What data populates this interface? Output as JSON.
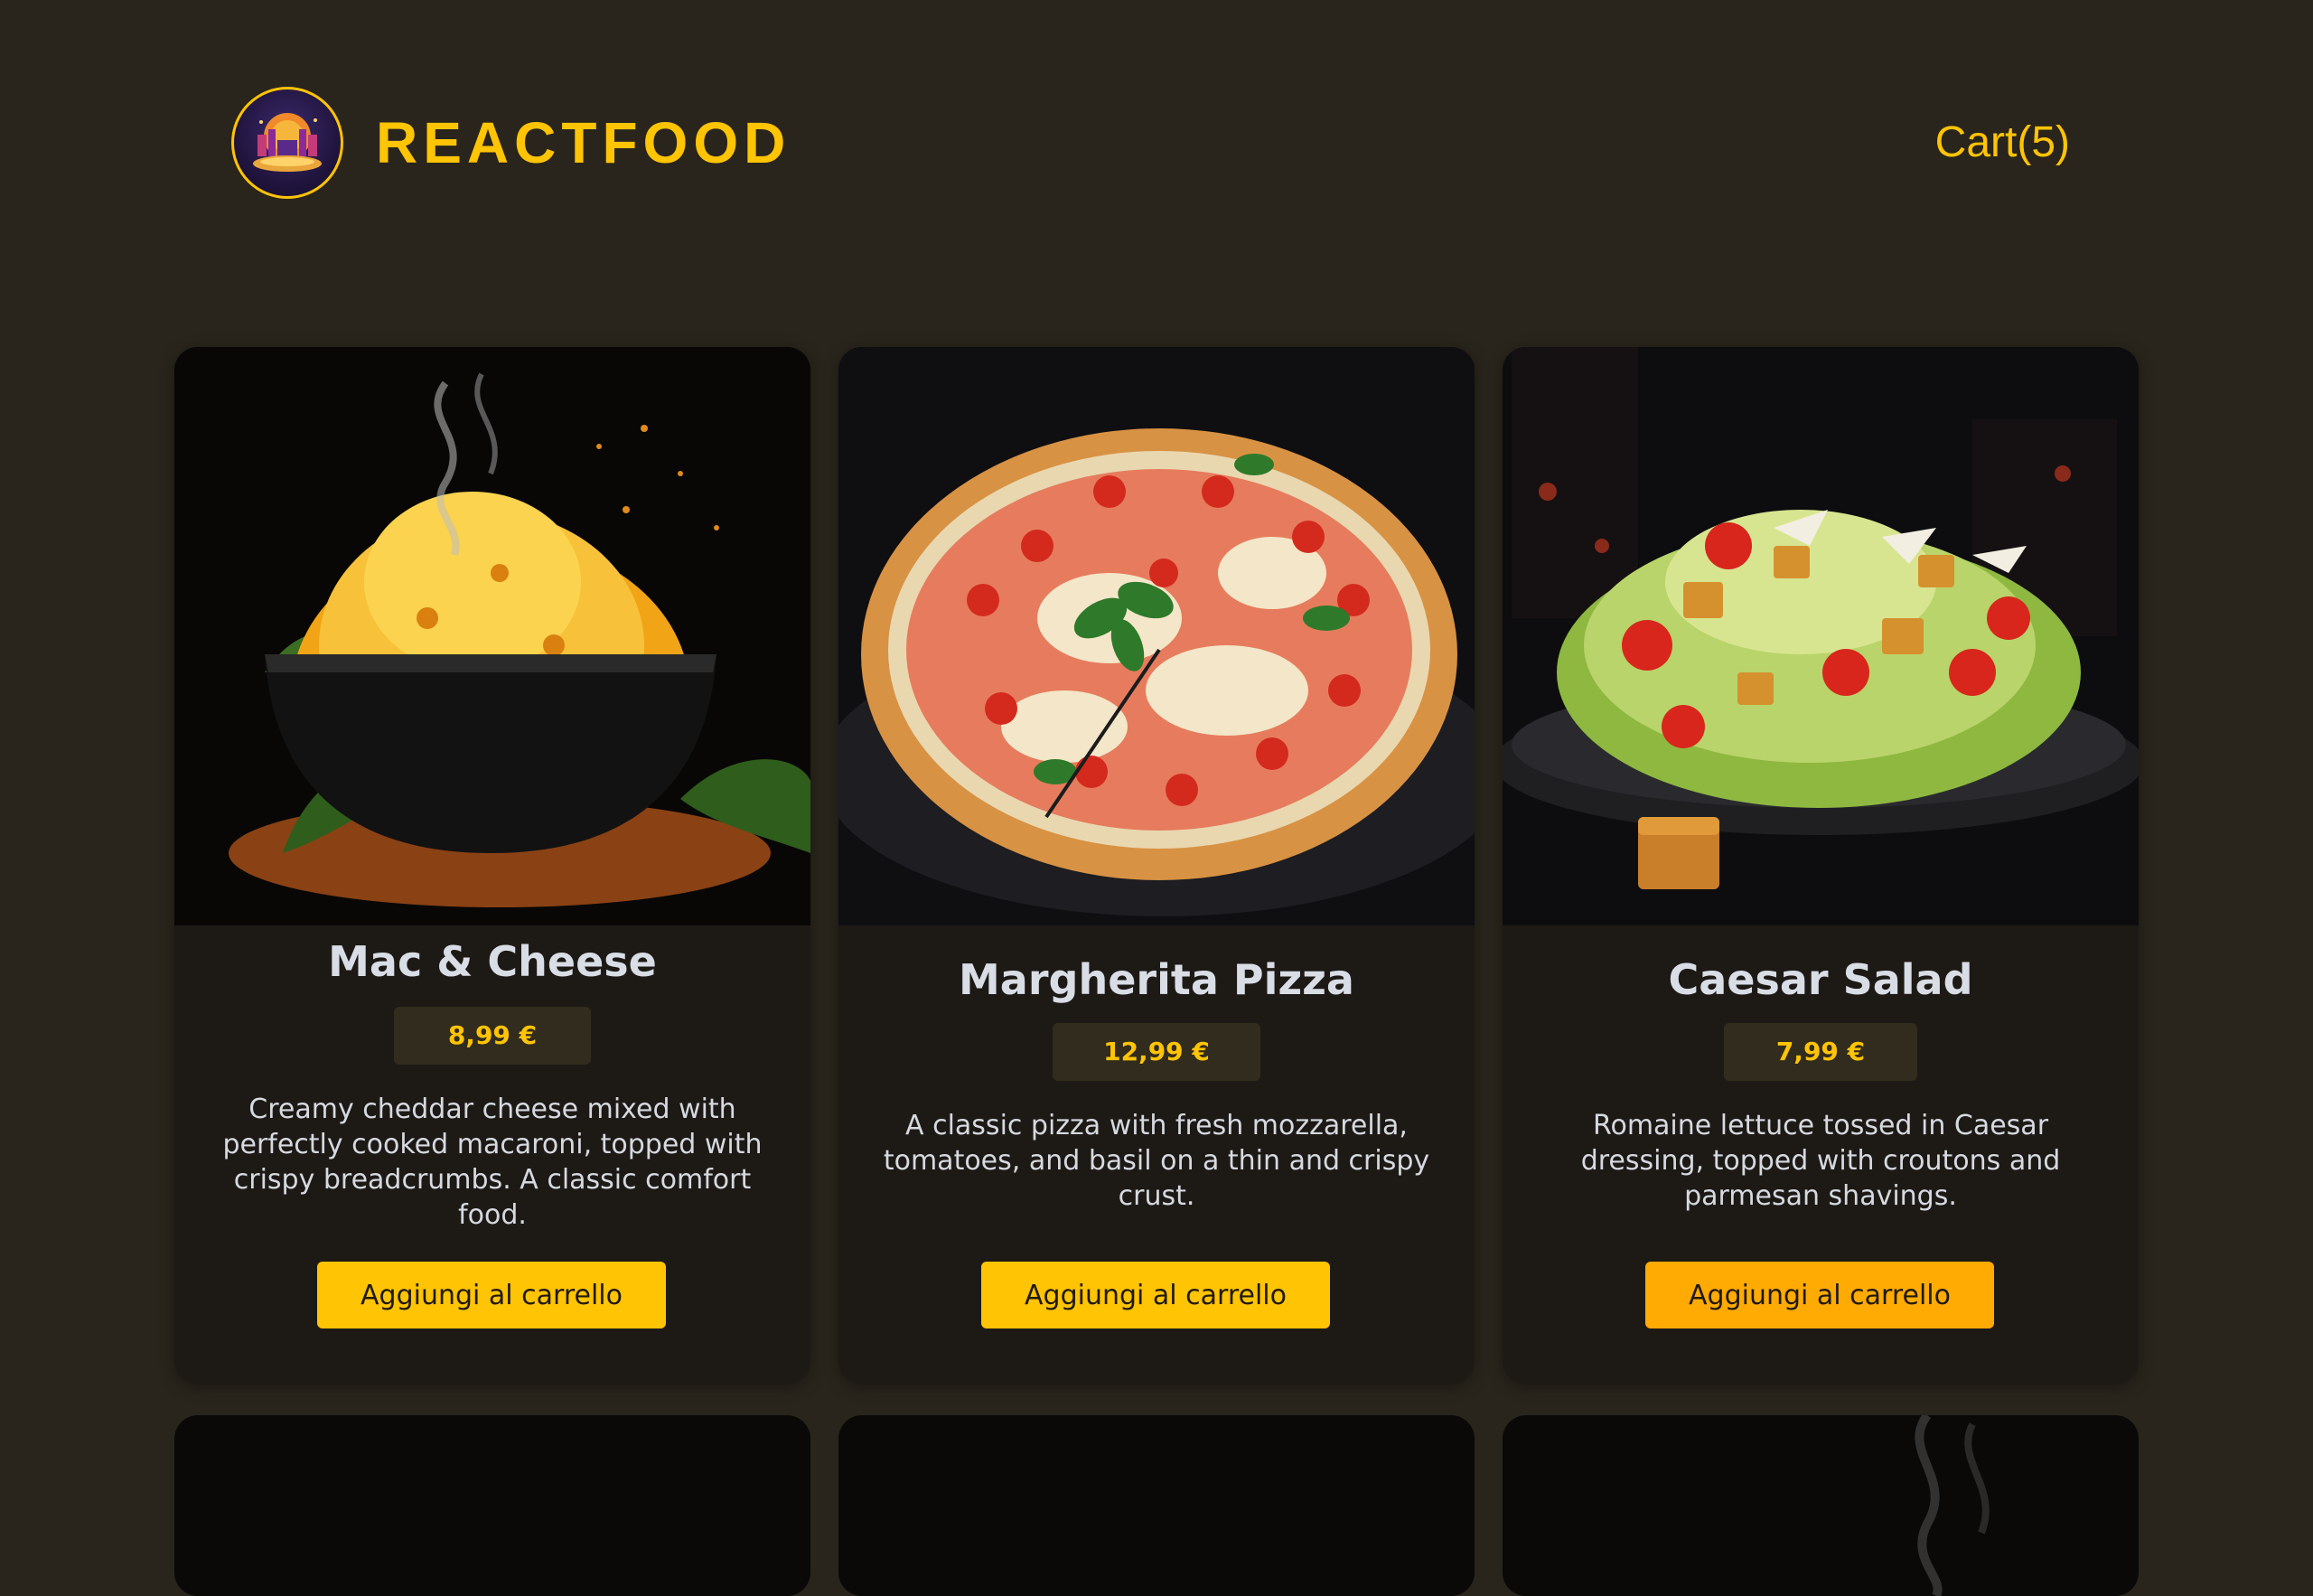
{
  "header": {
    "brand": "REACTFOOD",
    "cart_label": "Cart(5)",
    "logo_icon": "restaurant-logo-icon"
  },
  "menu": [
    {
      "name": "Mac & Cheese",
      "price": "8,99 €",
      "description": "Creamy cheddar cheese mixed with perfectly cooked macaroni, topped with crispy breadcrumbs. A classic comfort food.",
      "button": "Aggiungi al carrello"
    },
    {
      "name": "Margherita Pizza",
      "price": "12,99 €",
      "description": "A classic pizza with fresh mozzarella, tomatoes, and basil on a thin and crispy crust.",
      "button": "Aggiungi al carrello"
    },
    {
      "name": "Caesar Salad",
      "price": "7,99 €",
      "description": "Romaine lettuce tossed in Caesar dressing, topped with croutons and parmesan shavings.",
      "button": "Aggiungi al carrello"
    }
  ],
  "colors": {
    "background": "#29251c",
    "accent": "#ffc404",
    "card": "#1d1a16",
    "price_badge": "#312c1d"
  }
}
